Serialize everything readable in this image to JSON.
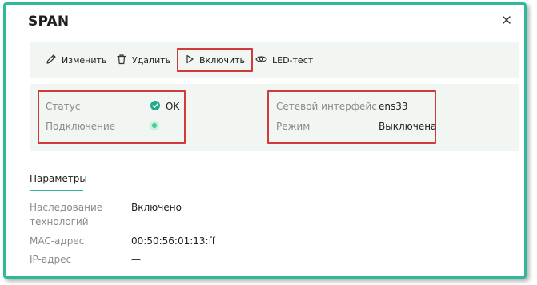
{
  "dialog": {
    "title": "SPAN"
  },
  "toolbar": {
    "edit_label": "Изменить",
    "delete_label": "Удалить",
    "enable_label": "Включить",
    "led_label": "LED-тест"
  },
  "status": {
    "status_label": "Статус",
    "status_value": "OK",
    "connection_label": "Подключение",
    "interface_label": "Сетевой интерфейс",
    "interface_value": "ens33",
    "mode_label": "Режим",
    "mode_value": "Выключена"
  },
  "tabs": [
    {
      "label": "Параметры",
      "active": true
    }
  ],
  "params": {
    "inheritance_label": "Наследование",
    "inheritance_label_2": "технологий",
    "inheritance_value": "Включено",
    "mac_label": "MAC-адрес",
    "mac_value": "00:50:56:01:13:ff",
    "ip_label": "IP-адрес",
    "ip_value": "—"
  },
  "colors": {
    "accent": "#2fb99a",
    "highlight": "#d03a3a",
    "status_ok": "#23a98a",
    "panel_bg": "#f1f6f3"
  },
  "icons": [
    "pencil-icon",
    "trash-icon",
    "play-icon",
    "eye-icon",
    "check-circle-icon",
    "close-icon"
  ]
}
